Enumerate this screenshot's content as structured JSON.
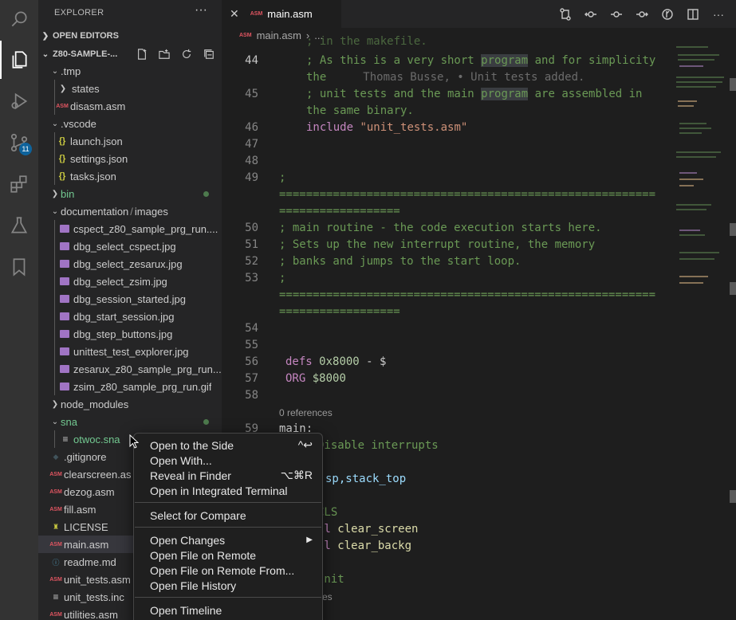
{
  "activity": {
    "items": [
      "search",
      "explorer",
      "run-and-debug",
      "source-control",
      "extensions",
      "testing",
      "bookmarks"
    ],
    "source_control_badge": "11"
  },
  "sidebar": {
    "title": "EXPLORER",
    "open_editors": "OPEN EDITORS",
    "project": "Z80-SAMPLE-...",
    "tree": [
      {
        "label": ".tmp"
      },
      {
        "label": "states"
      },
      {
        "label": "disasm.asm"
      },
      {
        "label": ".vscode"
      },
      {
        "label": "launch.json"
      },
      {
        "label": "settings.json"
      },
      {
        "label": "tasks.json"
      },
      {
        "label": "bin"
      },
      {
        "label": "documentation",
        "suffix": "images"
      },
      {
        "label": "cspect_z80_sample_prg_run...."
      },
      {
        "label": "dbg_select_cspect.jpg"
      },
      {
        "label": "dbg_select_zesarux.jpg"
      },
      {
        "label": "dbg_select_zsim.jpg"
      },
      {
        "label": "dbg_session_started.jpg"
      },
      {
        "label": "dbg_start_session.jpg"
      },
      {
        "label": "dbg_step_buttons.jpg"
      },
      {
        "label": "unittest_test_explorer.jpg"
      },
      {
        "label": "zesarux_z80_sample_prg_run..."
      },
      {
        "label": "zsim_z80_sample_prg_run.gif"
      },
      {
        "label": "node_modules"
      },
      {
        "label": "sna"
      },
      {
        "label": "otwoc.sna"
      },
      {
        "label": ".gitignore"
      },
      {
        "label": "clearscreen.as"
      },
      {
        "label": "dezog.asm"
      },
      {
        "label": "fill.asm"
      },
      {
        "label": "LICENSE"
      },
      {
        "label": "main.asm"
      },
      {
        "label": "readme.md"
      },
      {
        "label": "unit_tests.asm"
      },
      {
        "label": "unit_tests.inc"
      },
      {
        "label": "utilities.asm"
      }
    ]
  },
  "editor": {
    "tab": "main.asm",
    "breadcrumb_file": "main.asm",
    "breadcrumb_more": "...",
    "lines": {
      "top_partial": "; in the makefile.",
      "l44": "44",
      "l44_text": "; As this is a very short ",
      "l44_kw": "program",
      "l44_rest": " and for simplicity",
      "l44_wrap": "the",
      "blame": "Thomas Busse, • Unit tests added.",
      "l45": "45",
      "l45_text": "; unit tests and the main ",
      "l45_kw": "program",
      "l45_rest": " are assembled in",
      "l45_wrap": "the same binary.",
      "l46": "46",
      "l46_kw": "include",
      "l46_str": "\"unit_tests.asm\"",
      "l47": "47",
      "l48": "48",
      "l49": "49",
      "l49_text": ";",
      "sep1": "========================================================",
      "sep1b": "==================",
      "l50": "50",
      "l50_text": "; main routine - the code execution starts here.",
      "l51": "51",
      "l51_text": "; Sets up the new interrupt routine, the memory",
      "l52": "52",
      "l52_text": "; banks and jumps to the start loop.",
      "l53": "53",
      "l53_text": ";",
      "sep2": "========================================================",
      "sep2b": "==================",
      "l54": "54",
      "l55": "55",
      "l56": "56",
      "l56_kw": "defs",
      "l56_val": "0x8000",
      "l56_rest": " - $",
      "l57": "57",
      "l57_kw": "ORG",
      "l57_val": "$8000",
      "l58": "58",
      "refs": "0 references",
      "l59": "59",
      "l59_text": "main:",
      "frag1": "Disable interrupts",
      "frag2": "sp,stack_top",
      "frag3": "CLS",
      "frag4a": "ll ",
      "frag4b": "clear_screen",
      "frag5a": "ll ",
      "frag5b": "clear_backg",
      "frag6": "Init",
      "frag7": "ces"
    }
  },
  "context_menu": {
    "items": [
      {
        "label": "Open to the Side",
        "shortcut": "^↩"
      },
      {
        "label": "Open With..."
      },
      {
        "label": "Reveal in Finder",
        "shortcut": "⌥⌘R"
      },
      {
        "label": "Open in Integrated Terminal"
      },
      {
        "label": "Select for Compare"
      },
      {
        "label": "Open Changes",
        "shortcut": "▶"
      },
      {
        "label": "Open File on Remote"
      },
      {
        "label": "Open File on Remote From..."
      },
      {
        "label": "Open File History"
      },
      {
        "label": "Open Timeline"
      }
    ]
  }
}
